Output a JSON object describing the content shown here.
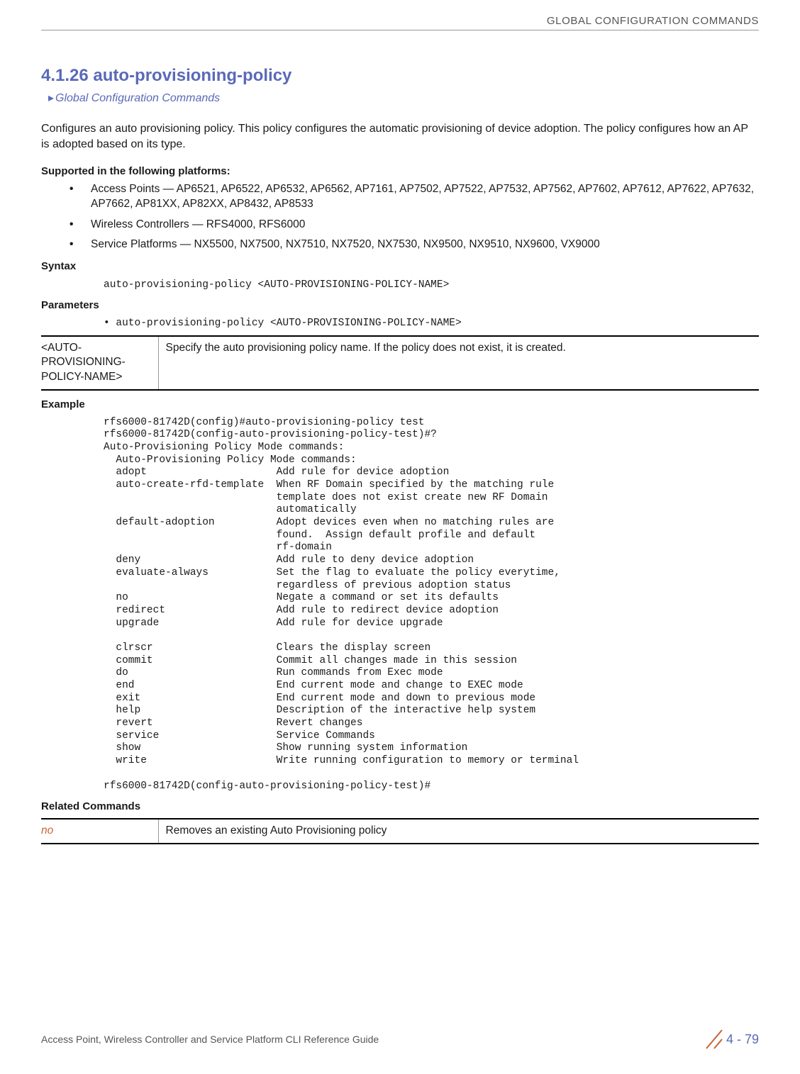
{
  "header": {
    "section": "GLOBAL CONFIGURATION COMMANDS"
  },
  "title": "4.1.26 auto-provisioning-policy",
  "breadcrumb": {
    "arrow": "▸",
    "text": "Global Configuration Commands"
  },
  "description": "Configures an auto provisioning policy. This policy configures the automatic provisioning of device adoption. The policy configures how an AP is adopted based on its type.",
  "supported_heading": "Supported in the following platforms:",
  "supported": [
    "Access Points — AP6521, AP6522, AP6532, AP6562, AP7161, AP7502, AP7522, AP7532, AP7562, AP7602, AP7612, AP7622, AP7632, AP7662, AP81XX, AP82XX, AP8432, AP8533",
    "Wireless Controllers — RFS4000, RFS6000",
    "Service Platforms — NX5500, NX7500, NX7510, NX7520, NX7530, NX9500, NX9510, NX9600, VX9000"
  ],
  "syntax_heading": "Syntax",
  "syntax_code": "auto-provisioning-policy <AUTO-PROVISIONING-POLICY-NAME>",
  "parameters_heading": "Parameters",
  "parameters_bullet": "• auto-provisioning-policy <AUTO-PROVISIONING-POLICY-NAME>",
  "param_table": {
    "name": "<AUTO-PROVISIONING-POLICY-NAME>",
    "desc": "Specify the auto provisioning policy name. If the policy does not exist, it is created."
  },
  "example_heading": "Example",
  "example_code": "rfs6000-81742D(config)#auto-provisioning-policy test\nrfs6000-81742D(config-auto-provisioning-policy-test)#?\nAuto-Provisioning Policy Mode commands:\n  Auto-Provisioning Policy Mode commands:\n  adopt                     Add rule for device adoption\n  auto-create-rfd-template  When RF Domain specified by the matching rule\n                            template does not exist create new RF Domain\n                            automatically\n  default-adoption          Adopt devices even when no matching rules are\n                            found.  Assign default profile and default\n                            rf-domain\n  deny                      Add rule to deny device adoption\n  evaluate-always           Set the flag to evaluate the policy everytime,\n                            regardless of previous adoption status\n  no                        Negate a command or set its defaults\n  redirect                  Add rule to redirect device adoption\n  upgrade                   Add rule for device upgrade\n\n  clrscr                    Clears the display screen\n  commit                    Commit all changes made in this session\n  do                        Run commands from Exec mode\n  end                       End current mode and change to EXEC mode\n  exit                      End current mode and down to previous mode\n  help                      Description of the interactive help system\n  revert                    Revert changes\n  service                   Service Commands\n  show                      Show running system information\n  write                     Write running configuration to memory or terminal\n\nrfs6000-81742D(config-auto-provisioning-policy-test)#",
  "related_heading": "Related Commands",
  "related_table": {
    "cmd": "no",
    "desc": "Removes an existing Auto Provisioning policy"
  },
  "footer": {
    "left": "Access Point, Wireless Controller and Service Platform CLI Reference Guide",
    "page": "4 - 79"
  }
}
